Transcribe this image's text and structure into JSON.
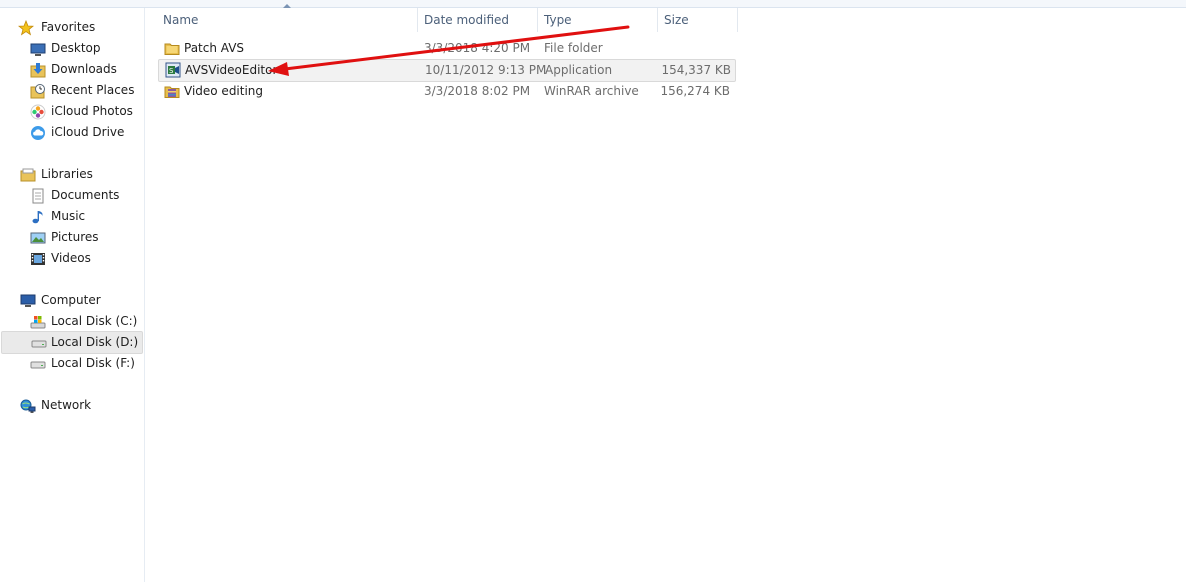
{
  "columns": {
    "name": "Name",
    "date": "Date modified",
    "type": "Type",
    "size": "Size"
  },
  "nav": {
    "favorites": {
      "label": "Favorites",
      "items": [
        {
          "label": "Desktop",
          "icon": "desktop-icon"
        },
        {
          "label": "Downloads",
          "icon": "downloads-icon"
        },
        {
          "label": "Recent Places",
          "icon": "recent-places-icon"
        },
        {
          "label": "iCloud Photos",
          "icon": "icloud-photos-icon"
        },
        {
          "label": "iCloud Drive",
          "icon": "icloud-drive-icon"
        }
      ]
    },
    "libraries": {
      "label": "Libraries",
      "items": [
        {
          "label": "Documents",
          "icon": "documents-icon"
        },
        {
          "label": "Music",
          "icon": "music-icon"
        },
        {
          "label": "Pictures",
          "icon": "pictures-icon"
        },
        {
          "label": "Videos",
          "icon": "videos-icon"
        }
      ]
    },
    "computer": {
      "label": "Computer",
      "items": [
        {
          "label": "Local Disk (C:)",
          "icon": "system-drive-icon"
        },
        {
          "label": "Local Disk (D:)",
          "icon": "drive-icon",
          "selected": true
        },
        {
          "label": "Local Disk (F:)",
          "icon": "drive-icon"
        }
      ]
    },
    "network": {
      "label": "Network"
    }
  },
  "files": [
    {
      "name": "Patch AVS",
      "date": "3/3/2018 4:20 PM",
      "type": "File folder",
      "size": "",
      "icon": "folder-icon"
    },
    {
      "name": "AVSVideoEditor",
      "date": "10/11/2012 9:13 PM",
      "type": "Application",
      "size": "154,337 KB",
      "icon": "application-icon",
      "selected": true
    },
    {
      "name": "Video editing",
      "date": "3/3/2018 8:02 PM",
      "type": "WinRAR archive",
      "size": "156,274 KB",
      "icon": "winrar-archive-icon"
    }
  ],
  "colors": {
    "annotation_arrow": "#e01010",
    "header_text": "#4c607a",
    "selection": "#f2f2f2"
  }
}
